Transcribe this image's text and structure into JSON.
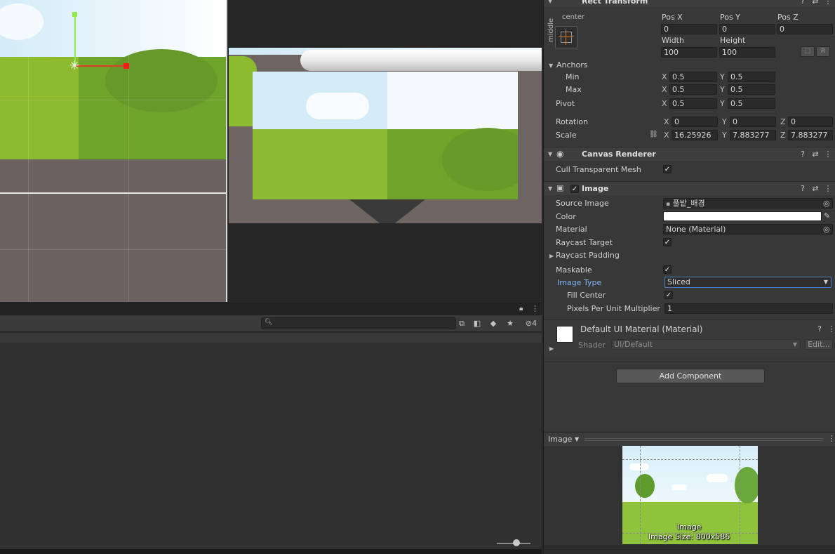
{
  "rect_transform": {
    "title": "Rect Transform",
    "anchor_preset_top": "center",
    "anchor_preset_side": "middle",
    "pos_x_label": "Pos X",
    "pos_y_label": "Pos Y",
    "pos_z_label": "Pos Z",
    "pos_x": "0",
    "pos_y": "0",
    "pos_z": "0",
    "width_label": "Width",
    "height_label": "Height",
    "width": "100",
    "height": "100",
    "blueprint_button": "R",
    "anchors_label": "Anchors",
    "min_label": "Min",
    "max_label": "Max",
    "min_x": "0.5",
    "min_y": "0.5",
    "max_x": "0.5",
    "max_y": "0.5",
    "pivot_label": "Pivot",
    "pivot_x": "0.5",
    "pivot_y": "0.5",
    "rotation_label": "Rotation",
    "rot_x": "0",
    "rot_y": "0",
    "rot_z": "0",
    "scale_label": "Scale",
    "scale_x": "16.25926",
    "scale_y": "7.883277",
    "scale_z": "7.883277",
    "axis_x": "X",
    "axis_y": "Y",
    "axis_z": "Z"
  },
  "canvas_renderer": {
    "title": "Canvas Renderer",
    "cull_label": "Cull Transparent Mesh",
    "cull_checked": "✓"
  },
  "image_component": {
    "title": "Image",
    "enabled_checked": "✓",
    "source_image_label": "Source Image",
    "source_image_value": "풀밭_배경",
    "color_label": "Color",
    "color_value": "#ffffff",
    "material_label": "Material",
    "material_value": "None (Material)",
    "raycast_target_label": "Raycast Target",
    "raycast_target_checked": "✓",
    "raycast_padding_label": "Raycast Padding",
    "maskable_label": "Maskable",
    "maskable_checked": "✓",
    "image_type_label": "Image Type",
    "image_type_value": "Sliced",
    "fill_center_label": "Fill Center",
    "fill_center_checked": "✓",
    "ppu_label": "Pixels Per Unit Multiplier",
    "ppu_value": "1"
  },
  "material_block": {
    "title": "Default UI Material (Material)",
    "shader_label": "Shader",
    "shader_value": "UI/Default",
    "edit_label": "Edit..."
  },
  "add_component_label": "Add Component",
  "preview": {
    "dropdown_label": "Image",
    "name": "Image",
    "size_text": "Image Size: 800x586"
  },
  "bottom_panel": {
    "hidden_count": "4"
  },
  "colors": {
    "accent_link": "#7fb4f5",
    "inspector_bg": "#383838"
  }
}
